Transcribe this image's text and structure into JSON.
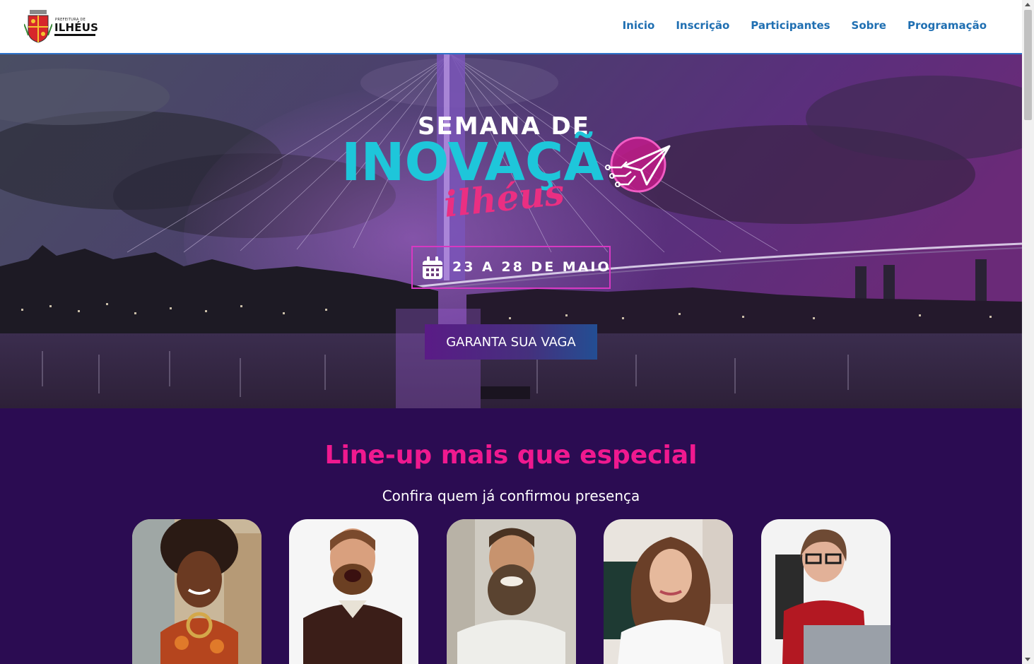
{
  "header": {
    "logo": {
      "prefix": "PREFEITURA DE",
      "name": "ILHÉUS"
    },
    "nav": [
      {
        "label": "Inicio"
      },
      {
        "label": "Inscrição"
      },
      {
        "label": "Participantes"
      },
      {
        "label": "Sobre"
      },
      {
        "label": "Programação"
      }
    ]
  },
  "hero": {
    "title_line1": "SEMANA DE",
    "title_line2": "INOVAÇÃ",
    "title_line3": "ilhéus",
    "date": "23 A 28 DE MAIO",
    "cta_label": "GARANTA SUA VAGA",
    "calendar_icon": "calendar-icon",
    "badge_icon": "paper-plane-circuit-icon"
  },
  "lineup": {
    "title": "Line-up mais que especial",
    "subtitle": "Confira quem já confirmou presença",
    "speakers_visible": 5
  },
  "colors": {
    "nav_link": "#1f6fb2",
    "header_border": "#2e73c9",
    "title_cyan": "#1ec6da",
    "title_pink": "#ea2f82",
    "date_border": "#d739c2",
    "lineup_bg": "#2b0c52",
    "lineup_title": "#f0198f"
  }
}
